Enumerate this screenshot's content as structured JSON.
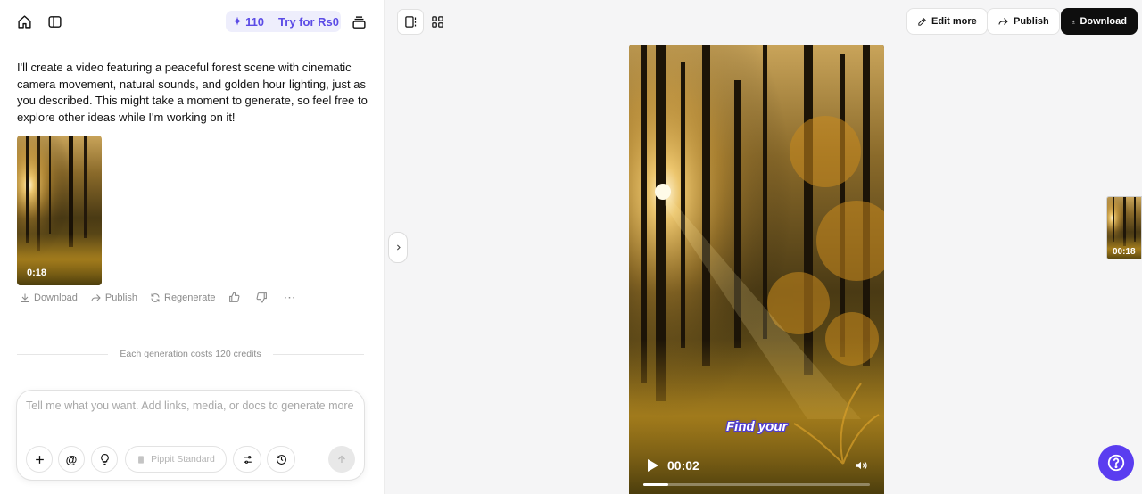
{
  "header": {
    "credits_count": "110",
    "try_label": "Try for Rs0",
    "home_icon": "home-icon",
    "sidebar_icon": "sidebar-toggle-icon",
    "stack_icon": "stack-icon"
  },
  "chat": {
    "message": "I'll create a video featuring a peaceful forest scene with cinematic camera movement, natural sounds, and golden hour lighting, just as you described. This might take a moment to generate, so feel free to explore other ideas while I'm working on it!",
    "video_duration": "0:18",
    "actions": {
      "download": "Download",
      "publish": "Publish",
      "regenerate": "Regenerate"
    },
    "cost_note": "Each generation costs 120 credits"
  },
  "composer": {
    "placeholder": "Tell me what you want. Add links, media, or docs to generate more",
    "model_label": "Pippit Standard"
  },
  "toolbar": {
    "edit_more": "Edit more",
    "publish": "Publish",
    "download": "Download"
  },
  "player": {
    "caption": "Find your",
    "current_time": "00:02",
    "progress_fraction": 0.11,
    "side_thumb_duration": "00:18"
  },
  "colors": {
    "accent": "#5a3df0",
    "pill_bg": "#eeeefc",
    "download_bg": "#0e0e0e"
  }
}
